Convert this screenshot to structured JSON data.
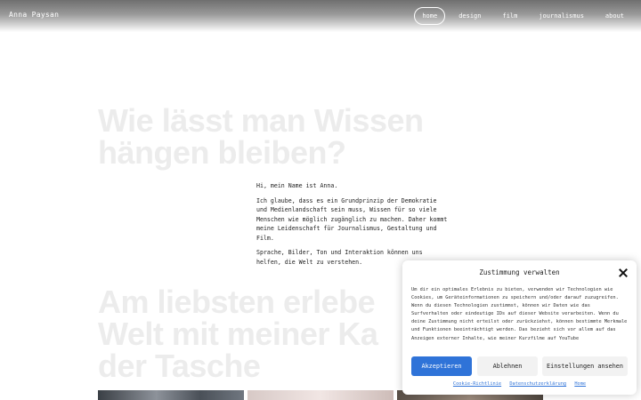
{
  "header": {
    "brand": "Anna Paysan",
    "nav": [
      "home",
      "design",
      "film",
      "journalismus",
      "about"
    ],
    "active_nav": "home"
  },
  "hero": {
    "headline_line1": "Wie lässt man Wissen",
    "headline_line2": "hängen bleiben?"
  },
  "intro": {
    "greeting": "Hi, mein Name ist Anna.",
    "paragraph1": "Ich glaube, dass es ein Grundprinzip der Demokratie und Medienlandschaft sein muss, Wissen für so viele Menschen wie möglich zugänglich zu machen. Daher kommt meine Leidenschaft für Journalismus, Gestaltung und Film.",
    "paragraph2": "Sprache, Bilder, Ton und Interaktion können uns helfen, die Welt zu verstehen."
  },
  "section2": {
    "line1": "Am liebsten erlebe",
    "line2": "Welt mit meiner Ka",
    "line3": "der Tasche"
  },
  "consent": {
    "title": "Zustimmung verwalten",
    "body": "Um dir ein optimales Erlebnis zu bieten, verwenden wir Technologien wie Cookies, um Geräteinformationen zu speichern und/oder darauf zuzugreifen. Wenn du diesen Technologien zustimmst, können wir Daten wie das Surfverhalten oder eindeutige IDs auf dieser Website verarbeiten. Wenn du deine Zustimmung nicht erteilst oder zurückziehst, können bestimmte Merkmale und Funktionen beeinträchtigt werden. Das bezieht sich vor allem auf das Anzeigen externer Inhalte, wie meiner Kurzfilme auf YouTube",
    "accept_label": "Akzeptieren",
    "deny_label": "Ablehnen",
    "settings_label": "Einstellungen ansehen",
    "links": [
      "Cookie-Richtlinie",
      "Datenschutzerklärung",
      "Home"
    ],
    "accent_color": "#2f73d8"
  }
}
